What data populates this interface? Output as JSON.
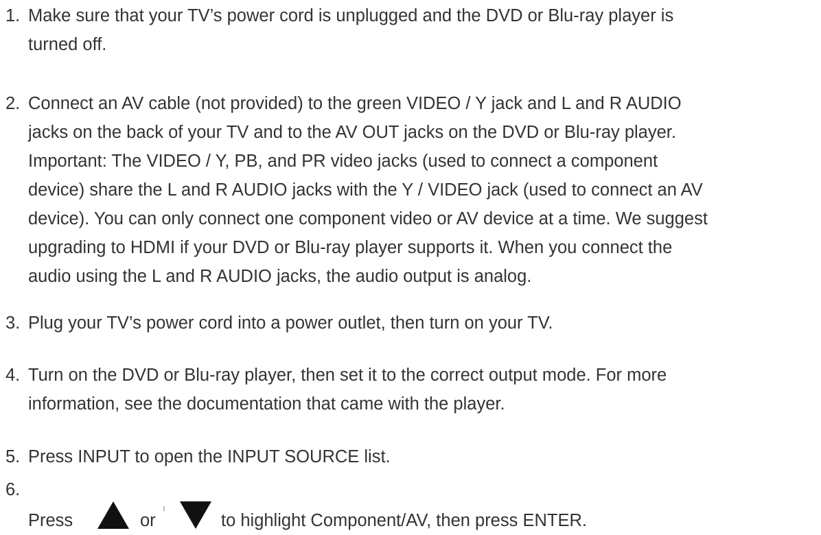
{
  "steps": [
    {
      "number": "1.",
      "lines": [
        "Make sure that your TV’s power cord is unplugged and the DVD or Blu-ray player is",
        "turned off."
      ]
    },
    {
      "number": "2.",
      "lines": [
        "Connect an AV cable (not provided) to the green VIDEO / Y jack and L and R AUDIO",
        "jacks on the back of your TV and to the AV OUT jacks on the DVD or Blu-ray player.",
        "Important: The VIDEO / Y, PB, and PR video jacks (used to connect a component",
        "device) share the L and R AUDIO jacks with the Y / VIDEO jack (used to connect an AV",
        "device). You can only connect one component video or AV device at a time. We suggest",
        "upgrading to HDMI if your DVD or Blu-ray player supports it. When you connect the",
        "audio using the L and R AUDIO jacks, the audio output is analog."
      ]
    },
    {
      "number": "3.",
      "lines": [
        "Plug your TV’s power cord into a power outlet, then turn on your TV."
      ]
    },
    {
      "number": "4.",
      "lines": [
        "Turn on the DVD or Blu-ray player, then set it to the correct output mode. For more",
        "information, see the documentation that came with the player."
      ]
    },
    {
      "number": "5.",
      "lines": [
        "Press INPUT to open the INPUT SOURCE list."
      ]
    },
    {
      "number": "6.",
      "press": "Press",
      "or": "or",
      "rest": "to highlight Component/AV, then press ENTER.",
      "up_icon": "up-triangle-button",
      "down_icon": "down-triangle-button"
    }
  ]
}
